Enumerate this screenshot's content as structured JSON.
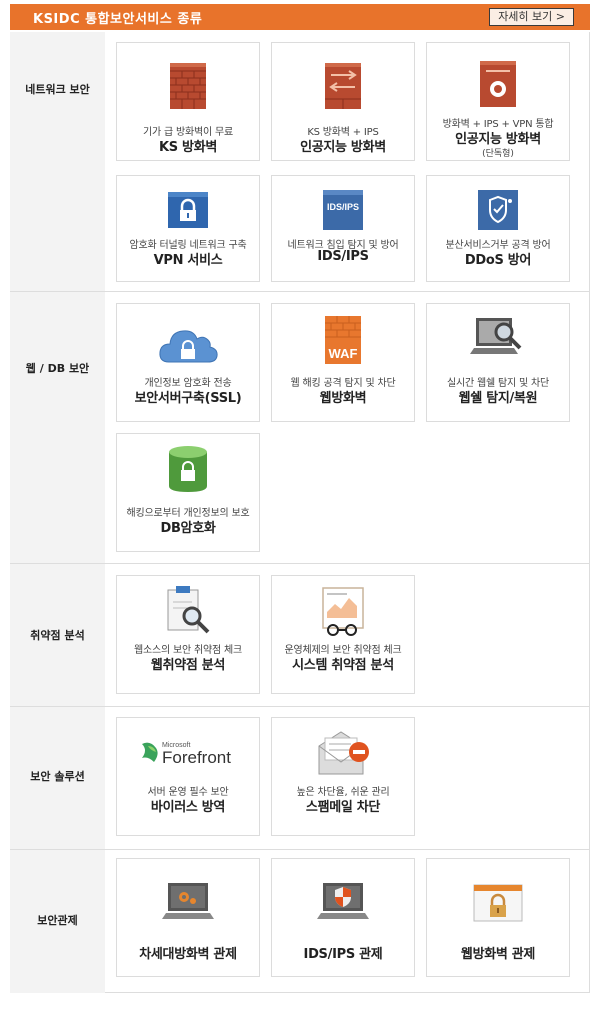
{
  "header": {
    "title": "KSIDC 통합보안서비스 종류",
    "more_label": "자세히 보기 >"
  },
  "sections": [
    {
      "label": "네트워크 보안",
      "cards": [
        {
          "icon": "firewall-icon",
          "sub": "기가 급 방화벽이 무료",
          "name": "KS 방화벽"
        },
        {
          "icon": "firewall-icon",
          "sub": "KS 방화벽 + IPS",
          "name": "인공지능 방화벽"
        },
        {
          "icon": "firewall-gear-icon",
          "sub": "방화벽 + IPS + VPN 통합",
          "name": "인공지능 방화벽",
          "note": "(단독형)"
        },
        {
          "icon": "lock-icon",
          "sub": "암호화 터널링 네트워크 구축",
          "name": "VPN 서비스"
        },
        {
          "icon": "ids-ips-icon",
          "sub": "네트워크 침입 탐지 및 방어",
          "name": "IDS/IPS",
          "icon_text": "IDS/IPS"
        },
        {
          "icon": "shield-icon",
          "sub": "분산서비스거부 공격 방어",
          "name": "DDoS 방어"
        }
      ]
    },
    {
      "label": "웹 / DB 보안",
      "cards": [
        {
          "icon": "cloud-lock-icon",
          "sub": "개인정보 암호화 전송",
          "name": "보안서버구축(SSL)"
        },
        {
          "icon": "waf-icon",
          "sub": "웹 해킹 공격 탐지 및 차단",
          "name": "웹방화벽",
          "icon_text": "WAF"
        },
        {
          "icon": "laptop-search-icon",
          "sub": "실시간 웹쉘 탐지 및 차단",
          "name": "웹쉘 탐지/복원"
        },
        {
          "icon": "database-lock-icon",
          "sub": "해킹으로부터 개인정보의 보호",
          "name": "DB암호화"
        }
      ]
    },
    {
      "label": "취약점 분석",
      "cards": [
        {
          "icon": "clipboard-search-icon",
          "sub": "웹소스의 보안 취약점 체크",
          "name": "웹취약점 분석"
        },
        {
          "icon": "report-glasses-icon",
          "sub": "운영체제의 보안 취약점 체크",
          "name": "시스템 취약점 분석"
        }
      ]
    },
    {
      "label": "보안 솔루션",
      "cards": [
        {
          "icon": "forefront-logo-icon",
          "sub": "서버 운영 필수 보안",
          "name": "바이러스 방역",
          "logo_small": "Microsoft",
          "logo_big": "Forefront"
        },
        {
          "icon": "mail-block-icon",
          "sub": "높은 차단율, 쉬운 관리",
          "name": "스팸메일 차단"
        }
      ]
    },
    {
      "label": "보안관제",
      "cards": [
        {
          "icon": "laptop-gear-icon",
          "name": "차세대방화벽 관제"
        },
        {
          "icon": "laptop-shield-icon",
          "name": "IDS/IPS 관제"
        },
        {
          "icon": "browser-lock-icon",
          "name": "웹방화벽 관제"
        }
      ]
    }
  ]
}
